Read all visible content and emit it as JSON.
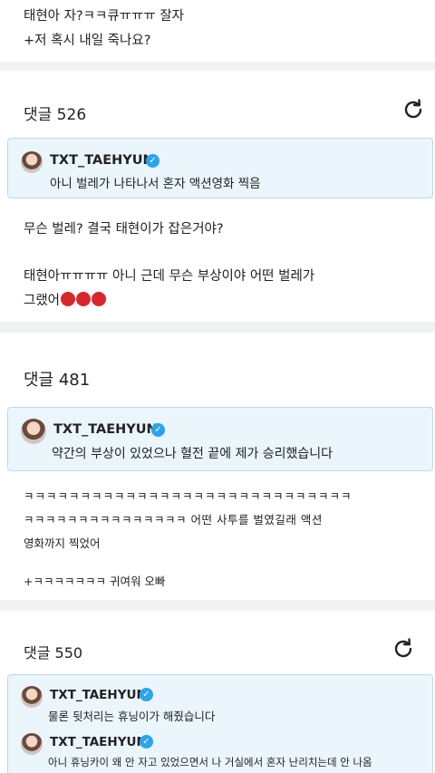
{
  "post_tail": {
    "line1": "태현아 자?ㅋㅋ큐ㅠㅠㅠ 잘자",
    "line2": "+저 혹시 내일 죽나요?"
  },
  "section1": {
    "count": "댓글 526",
    "reply": {
      "nick": "TXT_TAEHYUN",
      "text": "아니 벌레가 나타나서 혼자 액션영화 찍음"
    },
    "comment1": "무슨 벌레? 결국 태현이가 잡은거야?",
    "comment2_line1": "태현아ㅠㅠㅠㅠ 아니 근데 무슨 부상이야 어떤 벌레가",
    "comment2_line2": "그랬어"
  },
  "section2": {
    "count": "댓글 481",
    "reply": {
      "nick": "TXT_TAEHYUN",
      "text": "약간의 부상이 있었으나 혈전 끝에 제가 승리했습니다"
    },
    "comment1_line1": "ㅋㅋㅋㅋㅋㅋㅋㅋㅋㅋㅋㅋㅋㅋㅋㅋㅋㅋㅋㅋㅋㅋㅋㅋㅋㅋㅋㅋㅋ",
    "comment1_line2": "ㅋㅋㅋㅋㅋㅋㅋㅋㅋㅋㅋㅋㅋㅋㅋ 어떤 사투를 벌였길래 액션",
    "comment1_line3": "영화까지 찍었어",
    "comment2": "+ㅋㅋㅋㅋㅋㅋㅋ 귀여워 오빠"
  },
  "section3": {
    "count": "댓글 550",
    "reply1": {
      "nick": "TXT_TAEHYUN",
      "text": "물론 뒷처리는 휴닝이가 해줬습니다"
    },
    "reply2": {
      "nick": "TXT_TAEHYUN",
      "text": "아니 휴닝카이 왜 안 자고 있었으면서 나 거실에서 혼자 난리치는데 안 나옴"
    }
  },
  "icons": {
    "refresh": "refresh-icon",
    "verified": "verified-badge-icon",
    "emoji": "angry-face-emoji"
  },
  "colors": {
    "reply_bg": "#eaf5fc",
    "reply_border": "#b9dbef",
    "badge": "#2aa3f0",
    "separator": "#f1f2f4"
  }
}
